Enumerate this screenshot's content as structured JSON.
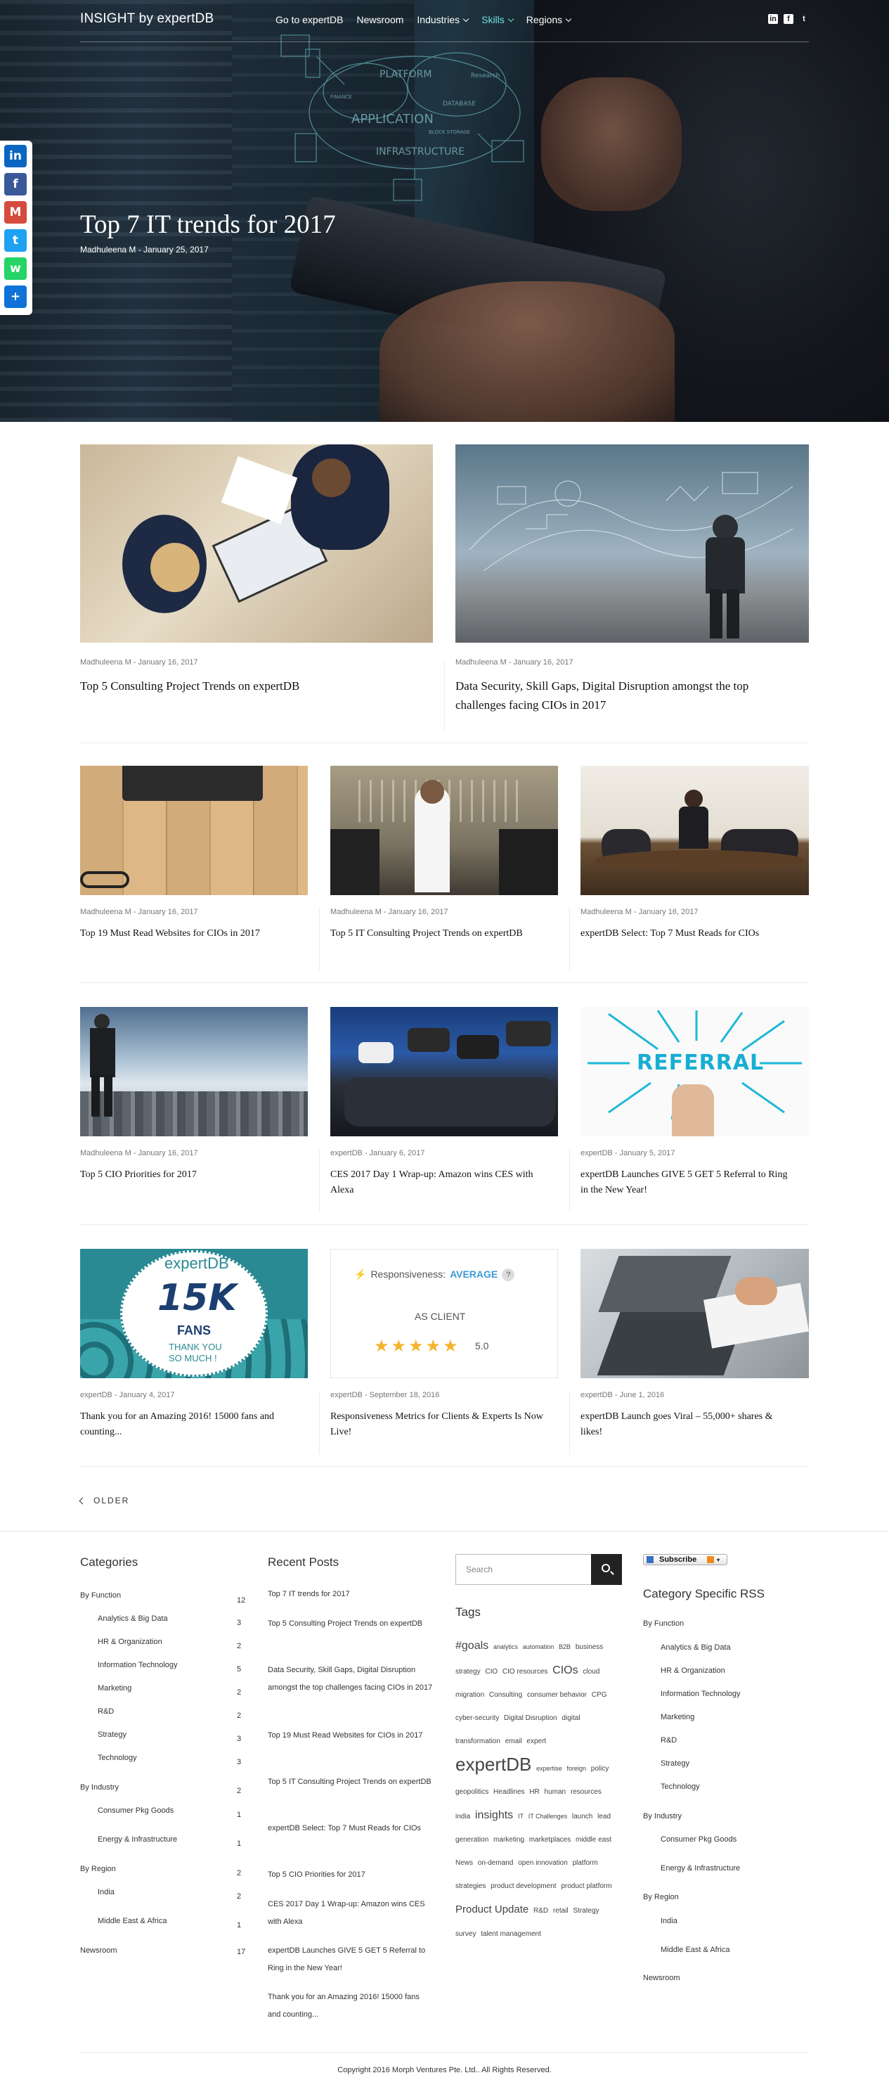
{
  "nav": {
    "brand": "INSIGHT by expertDB",
    "links": [
      {
        "label": "Go to expertDB",
        "dropdown": false
      },
      {
        "label": "Newsroom",
        "dropdown": false
      },
      {
        "label": "Industries",
        "dropdown": true
      },
      {
        "label": "Skills",
        "dropdown": true
      },
      {
        "label": "Regions",
        "dropdown": true
      }
    ],
    "social": [
      "linkedin-icon",
      "facebook-icon",
      "twitter-icon"
    ]
  },
  "share_bar": [
    {
      "name": "linkedin-share-icon",
      "glyph": "in",
      "color": "#0a66c2"
    },
    {
      "name": "facebook-share-icon",
      "glyph": "f",
      "color": "#3b5998"
    },
    {
      "name": "gmail-share-icon",
      "glyph": "M",
      "color": "#d54b3d"
    },
    {
      "name": "twitter-share-icon",
      "glyph": "t",
      "color": "#1da1f2"
    },
    {
      "name": "whatsapp-share-icon",
      "glyph": "w",
      "color": "#25d366"
    },
    {
      "name": "add-share-icon",
      "glyph": "+",
      "color": "#0e72d6"
    }
  ],
  "hero": {
    "title": "Top 7 IT trends for 2017",
    "meta": "Madhuleena M - January 25, 2017"
  },
  "posts": [
    {
      "meta": "Madhuleena M - January 16, 2017",
      "title": "Top 5 Consulting Project Trends on expertDB"
    },
    {
      "meta": "Madhuleena M - January 16, 2017",
      "title": "Data Security, Skill Gaps, Digital Disruption amongst the top challenges facing CIOs in 2017"
    },
    {
      "meta": "Madhuleena M - January 16, 2017",
      "title": "Top 19 Must Read Websites for CIOs in 2017"
    },
    {
      "meta": "Madhuleena M - January 16, 2017",
      "title": "Top 5 IT Consulting Project Trends on expertDB"
    },
    {
      "meta": "Madhuleena M - January 16, 2017",
      "title": "expertDB Select: Top 7 Must Reads for CIOs"
    },
    {
      "meta": "Madhuleena M - January 16, 2017",
      "title": "Top 5 CIO Priorities for 2017"
    },
    {
      "meta": "expertDB - January 6, 2017",
      "title": "CES 2017 Day 1 Wrap-up: Amazon wins CES with Alexa"
    },
    {
      "meta": "expertDB - January 5, 2017",
      "title": "expertDB Launches GIVE 5 GET 5 Referral to Ring in the New Year!"
    },
    {
      "meta": "expertDB - January 4, 2017",
      "title": "Thank you for an Amazing 2016! 15000 fans and counting..."
    },
    {
      "meta": "expertDB - September 18, 2016",
      "title": "Responsiveness Metrics for Clients & Experts Is Now Live!"
    },
    {
      "meta": "expertDB - June 1, 2016",
      "title": "expertDB Launch goes Viral – 55,000+ shares & likes!"
    }
  ],
  "image_text": {
    "referral": "REFERRAL",
    "fans_brand": "expertDB",
    "fans_count": "15K",
    "fans_label": "FANS",
    "fans_thanks1": "THANK YOU",
    "fans_thanks2": "SO MUCH !",
    "resp_label": "Responsiveness:",
    "resp_value": "AVERAGE",
    "resp_client": "AS CLIENT",
    "resp_score": "5.0"
  },
  "older_label": "OLDER",
  "categories": {
    "heading": "Categories",
    "items": [
      {
        "label": "By Function",
        "count": "12",
        "level": 0
      },
      {
        "label": "Analytics & Big Data",
        "count": "3",
        "level": 1
      },
      {
        "label": "HR & Organization",
        "count": "2",
        "level": 1
      },
      {
        "label": "Information Technology",
        "count": "5",
        "level": 1
      },
      {
        "label": "Marketing",
        "count": "2",
        "level": 1
      },
      {
        "label": "R&D",
        "count": "2",
        "level": 1
      },
      {
        "label": "Strategy",
        "count": "3",
        "level": 1
      },
      {
        "label": "Technology",
        "count": "3",
        "level": 1
      },
      {
        "label": "By Industry",
        "count": "2",
        "level": 0
      },
      {
        "label": "Consumer Pkg Goods",
        "count": "1",
        "level": 1
      },
      {
        "label": "Energy & Infrastructure",
        "count": "1",
        "level": 1
      },
      {
        "label": "By Region",
        "count": "2",
        "level": 0
      },
      {
        "label": "India",
        "count": "2",
        "level": 1
      },
      {
        "label": "Middle East & Africa",
        "count": "1",
        "level": 1
      },
      {
        "label": "Newsroom",
        "count": "17",
        "level": 0
      }
    ]
  },
  "recent_posts": {
    "heading": "Recent Posts",
    "items": [
      "Top 7 IT trends for 2017",
      "Top 5 Consulting Project Trends on expertDB",
      "Data Security, Skill Gaps, Digital Disruption amongst the top challenges facing CIOs in 2017",
      "Top 19 Must Read Websites for CIOs in 2017",
      "Top 5 IT Consulting Project Trends on expertDB",
      "expertDB Select: Top 7 Must Reads for CIOs",
      "Top 5 CIO Priorities for 2017",
      "CES 2017 Day 1 Wrap-up: Amazon wins CES with Alexa",
      "expertDB Launches GIVE 5 GET 5 Referral to Ring in the New Year!",
      "Thank you for an Amazing 2016! 15000 fans and counting..."
    ]
  },
  "search": {
    "placeholder": "Search"
  },
  "tags": {
    "heading": "Tags",
    "items": [
      {
        "t": "#goals",
        "s": 16
      },
      {
        "t": "analytics",
        "s": 9
      },
      {
        "t": "automation",
        "s": 9
      },
      {
        "t": "B2B",
        "s": 9
      },
      {
        "t": "business",
        "s": 10
      },
      {
        "t": "strategy",
        "s": 10
      },
      {
        "t": "CIO",
        "s": 10
      },
      {
        "t": "CIO resources",
        "s": 10
      },
      {
        "t": "CIOs",
        "s": 16
      },
      {
        "t": "cloud",
        "s": 10
      },
      {
        "t": "migration",
        "s": 10
      },
      {
        "t": "Consulting",
        "s": 10
      },
      {
        "t": "consumer behavior",
        "s": 10
      },
      {
        "t": "CPG",
        "s": 10
      },
      {
        "t": "cyber-security",
        "s": 10
      },
      {
        "t": "Digital Disruption",
        "s": 10
      },
      {
        "t": "digital",
        "s": 10
      },
      {
        "t": "transformation",
        "s": 10
      },
      {
        "t": "email",
        "s": 10
      },
      {
        "t": "expert",
        "s": 10
      },
      {
        "t": "expertDB",
        "s": 26
      },
      {
        "t": "expertise",
        "s": 9
      },
      {
        "t": "foreign",
        "s": 9
      },
      {
        "t": "policy",
        "s": 10
      },
      {
        "t": "geopolitics",
        "s": 10
      },
      {
        "t": "Headlines",
        "s": 10
      },
      {
        "t": "HR",
        "s": 10
      },
      {
        "t": "human",
        "s": 10
      },
      {
        "t": "resources",
        "s": 10
      },
      {
        "t": "india",
        "s": 10
      },
      {
        "t": "insights",
        "s": 16
      },
      {
        "t": "IT",
        "s": 9
      },
      {
        "t": "IT Challenges",
        "s": 9
      },
      {
        "t": "launch",
        "s": 10
      },
      {
        "t": "lead generation",
        "s": 10
      },
      {
        "t": "marketing",
        "s": 10
      },
      {
        "t": "marketplaces",
        "s": 10
      },
      {
        "t": "middle east",
        "s": 10
      },
      {
        "t": "News",
        "s": 10
      },
      {
        "t": "on-demand",
        "s": 10
      },
      {
        "t": "open innovation",
        "s": 10
      },
      {
        "t": "platform strategies",
        "s": 10
      },
      {
        "t": "product development",
        "s": 10
      },
      {
        "t": "product platform",
        "s": 10
      },
      {
        "t": "Product Update",
        "s": 15
      },
      {
        "t": "R&D",
        "s": 10
      },
      {
        "t": "retail",
        "s": 10
      },
      {
        "t": "Strategy",
        "s": 10
      },
      {
        "t": "survey",
        "s": 10
      },
      {
        "t": "talent management",
        "s": 10
      }
    ]
  },
  "subscribe": {
    "label": "Subscribe"
  },
  "rss": {
    "heading": "Category Specific RSS",
    "items": [
      {
        "label": "By Function",
        "level": 0
      },
      {
        "label": "Analytics & Big Data",
        "level": 1
      },
      {
        "label": "HR & Organization",
        "level": 1
      },
      {
        "label": "Information Technology",
        "level": 1
      },
      {
        "label": "Marketing",
        "level": 1
      },
      {
        "label": "R&D",
        "level": 1
      },
      {
        "label": "Strategy",
        "level": 1
      },
      {
        "label": "Technology",
        "level": 1
      },
      {
        "label": "By Industry",
        "level": 0
      },
      {
        "label": "Consumer Pkg Goods",
        "level": 1
      },
      {
        "label": "Energy & Infrastructure",
        "level": 1
      },
      {
        "label": "By Region",
        "level": 0
      },
      {
        "label": "India",
        "level": 1
      },
      {
        "label": "Middle East & Africa",
        "level": 1
      },
      {
        "label": "Newsroom",
        "level": 0
      }
    ]
  },
  "copyright": "Copyright 2016 Morph Ventures Pte. Ltd.. All Rights Reserved."
}
